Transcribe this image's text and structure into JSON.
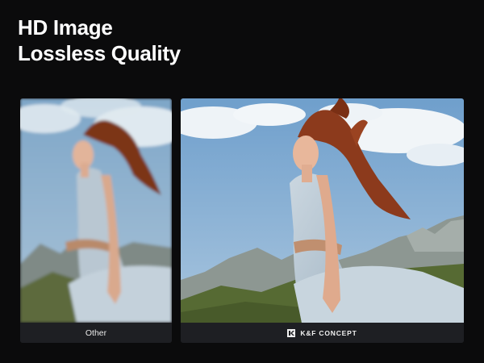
{
  "headline": {
    "line1": "HD Image",
    "line2": "Lossless Quality"
  },
  "comparison": {
    "left": {
      "caption": "Other",
      "quality": "blurred"
    },
    "right": {
      "brand": "K&F CONCEPT",
      "brand_icon": "kf-logo-icon",
      "quality": "sharp"
    }
  },
  "colors": {
    "background": "#0b0b0c",
    "caption_bar": "#1e1f23",
    "sky": "#8fb6d9",
    "hair": "#8a3b1f",
    "dress": "#b7c6d2"
  }
}
